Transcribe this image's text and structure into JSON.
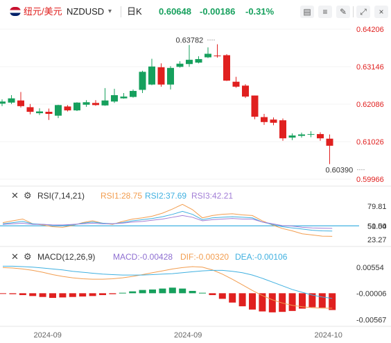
{
  "toolbar": {
    "pair_cn": "纽元/美元",
    "symbol": "NZDUSD",
    "dropdown_glyph": "▾",
    "period": "日K",
    "price": "0.60648",
    "change": "-0.00186",
    "change_pct": "-0.31%",
    "icons": [
      "candle-style-icon",
      "indicator-icon",
      "draw-tool-icon",
      "settings-icon",
      "fullscreen-icon",
      "close-icon"
    ]
  },
  "colors": {
    "up": "#16a05d",
    "down": "#e0201f",
    "axis_text": "#e0201f",
    "rsi1": "#f29d4f",
    "rsi2": "#3fb0e0",
    "rsi3": "#a27ed6",
    "macd_label": "#8e6fd1",
    "dif": "#f29d4f",
    "dea": "#3fb0e0"
  },
  "chart_data": [
    {
      "type": "candlestick",
      "title": "NZDUSD 日K",
      "y_ticks": [
        "0.64206",
        "0.63146",
        "0.62086",
        "0.61026",
        "0.59966"
      ],
      "ylim": [
        0.59966,
        0.64206
      ],
      "annotations": [
        {
          "label": "0.63782",
          "candle_index": 23,
          "value": 0.63782
        },
        {
          "label": "0.60390",
          "candle_index": 39,
          "value": 0.6039
        }
      ],
      "x_ticks": [
        {
          "label": "2024-09",
          "candle_index": 5
        },
        {
          "label": "2024-09",
          "candle_index": 20
        },
        {
          "label": "2024-10",
          "candle_index": 35
        }
      ],
      "candles": [
        {
          "o": 0.621,
          "c": 0.6216,
          "h": 0.6222,
          "l": 0.6203
        },
        {
          "o": 0.6213,
          "c": 0.6225,
          "h": 0.6234,
          "l": 0.6209
        },
        {
          "o": 0.6219,
          "c": 0.6203,
          "h": 0.6243,
          "l": 0.6199
        },
        {
          "o": 0.62,
          "c": 0.6187,
          "h": 0.6209,
          "l": 0.618
        },
        {
          "o": 0.6183,
          "c": 0.6188,
          "h": 0.6197,
          "l": 0.6178
        },
        {
          "o": 0.6187,
          "c": 0.6181,
          "h": 0.6196,
          "l": 0.6164
        },
        {
          "o": 0.6176,
          "c": 0.6206,
          "h": 0.6207,
          "l": 0.6169
        },
        {
          "o": 0.6202,
          "c": 0.6191,
          "h": 0.6206,
          "l": 0.6188
        },
        {
          "o": 0.6191,
          "c": 0.6213,
          "h": 0.6214,
          "l": 0.6189
        },
        {
          "o": 0.6207,
          "c": 0.6214,
          "h": 0.622,
          "l": 0.6201
        },
        {
          "o": 0.6212,
          "c": 0.6206,
          "h": 0.622,
          "l": 0.6204
        },
        {
          "o": 0.6205,
          "c": 0.6219,
          "h": 0.6254,
          "l": 0.6204
        },
        {
          "o": 0.6216,
          "c": 0.6234,
          "h": 0.6252,
          "l": 0.6212
        },
        {
          "o": 0.6225,
          "c": 0.623,
          "h": 0.624,
          "l": 0.6224
        },
        {
          "o": 0.6229,
          "c": 0.6246,
          "h": 0.625,
          "l": 0.6227
        },
        {
          "o": 0.6249,
          "c": 0.63,
          "h": 0.6303,
          "l": 0.624
        },
        {
          "o": 0.6264,
          "c": 0.6315,
          "h": 0.6337,
          "l": 0.6262
        },
        {
          "o": 0.6313,
          "c": 0.6264,
          "h": 0.6324,
          "l": 0.6258
        },
        {
          "o": 0.6264,
          "c": 0.6311,
          "h": 0.6316,
          "l": 0.625
        },
        {
          "o": 0.6314,
          "c": 0.6323,
          "h": 0.633,
          "l": 0.6312
        },
        {
          "o": 0.6322,
          "c": 0.6334,
          "h": 0.6376,
          "l": 0.6314
        },
        {
          "o": 0.6326,
          "c": 0.6336,
          "h": 0.6344,
          "l": 0.6324
        },
        {
          "o": 0.6341,
          "c": 0.6351,
          "h": 0.6369,
          "l": 0.6339
        },
        {
          "o": 0.6346,
          "c": 0.6345,
          "h": 0.6378,
          "l": 0.634
        },
        {
          "o": 0.6347,
          "c": 0.6275,
          "h": 0.635,
          "l": 0.6274
        },
        {
          "o": 0.6272,
          "c": 0.6258,
          "h": 0.6286,
          "l": 0.6255
        },
        {
          "o": 0.6261,
          "c": 0.623,
          "h": 0.6265,
          "l": 0.6226
        },
        {
          "o": 0.6233,
          "c": 0.6173,
          "h": 0.6233,
          "l": 0.6166
        },
        {
          "o": 0.6172,
          "c": 0.6158,
          "h": 0.6181,
          "l": 0.615
        },
        {
          "o": 0.6165,
          "c": 0.6156,
          "h": 0.6171,
          "l": 0.6149
        },
        {
          "o": 0.6163,
          "c": 0.6112,
          "h": 0.6168,
          "l": 0.6105
        },
        {
          "o": 0.6114,
          "c": 0.612,
          "h": 0.6126,
          "l": 0.6107
        },
        {
          "o": 0.6119,
          "c": 0.6123,
          "h": 0.6128,
          "l": 0.6114
        },
        {
          "o": 0.6123,
          "c": 0.6124,
          "h": 0.6132,
          "l": 0.6115
        },
        {
          "o": 0.6124,
          "c": 0.6112,
          "h": 0.6129,
          "l": 0.6105
        },
        {
          "o": 0.6111,
          "c": 0.6091,
          "h": 0.6123,
          "l": 0.6039
        }
      ]
    },
    {
      "type": "line",
      "title": "RSI(7,14,21)",
      "legend": [
        {
          "name": "RSI1",
          "label": "RSI1:28.75"
        },
        {
          "name": "RSI2",
          "label": "RSI2:37.69"
        },
        {
          "name": "RSI3",
          "label": "RSI3:42.21"
        }
      ],
      "y_ticks": [
        "79.81",
        "50.00",
        "51.54",
        "23.27"
      ],
      "ylim": [
        15,
        88
      ],
      "reference_value": 50.0,
      "series": [
        {
          "name": "RSI1",
          "values": [
            52,
            55,
            58,
            50,
            48,
            45,
            44,
            47,
            52,
            55,
            51,
            49,
            54,
            58,
            60,
            63,
            68,
            75,
            83,
            74,
            60,
            64,
            66,
            67,
            65,
            64,
            55,
            48,
            42,
            38,
            33,
            31,
            29,
            28.75
          ]
        },
        {
          "name": "RSI2",
          "values": [
            50,
            52,
            54,
            50,
            49,
            48,
            47,
            48,
            51,
            53,
            51,
            50,
            52,
            55,
            57,
            59,
            62,
            66,
            71,
            66,
            57,
            60,
            61,
            62,
            61,
            60,
            53,
            49,
            45,
            43,
            41,
            39,
            38,
            37.69
          ]
        },
        {
          "name": "RSI3",
          "values": [
            49,
            50,
            51,
            49,
            49,
            48,
            48,
            49,
            50,
            51,
            50,
            50,
            51,
            53,
            54,
            56,
            58,
            61,
            64,
            61,
            55,
            57,
            58,
            59,
            58,
            58,
            53,
            50,
            47,
            46,
            44,
            43,
            42.5,
            42.21
          ]
        }
      ]
    },
    {
      "type": "bar+line",
      "title": "MACD(12,26,9)",
      "legend": [
        {
          "name": "MACD",
          "label": "MACD:-0.00428"
        },
        {
          "name": "DIF",
          "label": "DIF:-0.00320"
        },
        {
          "name": "DEA",
          "label": "DEA:-0.00106"
        }
      ],
      "y_ticks": [
        "0.00554",
        "-0.00006",
        "-0.00567"
      ],
      "ylim": [
        -0.0068,
        0.0066
      ],
      "histogram": [
        -0.00012,
        -0.0002,
        -0.0004,
        -0.0006,
        -0.0008,
        -0.001,
        -0.0009,
        -0.0008,
        -0.0007,
        -0.0006,
        -0.0004,
        -0.0002,
        0.0001,
        0.0004,
        0.0007,
        0.0008,
        0.001,
        0.0012,
        0.001,
        0.0005,
        0.0001,
        -0.0004,
        -0.0012,
        -0.002,
        -0.0028,
        -0.0035,
        -0.0039,
        -0.0041,
        -0.004,
        -0.0038,
        -0.0033,
        -0.003,
        -0.0031,
        -0.0036
      ],
      "series": [
        {
          "name": "DIF",
          "values": [
            0.0055,
            0.0054,
            0.0052,
            0.0049,
            0.0045,
            0.004,
            0.0036,
            0.0033,
            0.0031,
            0.003,
            0.003,
            0.0031,
            0.0033,
            0.0036,
            0.004,
            0.0044,
            0.0048,
            0.0052,
            0.0055,
            0.0057,
            0.0056,
            0.005,
            0.0041,
            0.003,
            0.0018,
            0.0006,
            -0.0005,
            -0.0014,
            -0.0021,
            -0.0026,
            -0.0029,
            -0.0031,
            -0.0032,
            -0.0032
          ]
        },
        {
          "name": "DEA",
          "values": [
            0.0058,
            0.0058,
            0.0057,
            0.0056,
            0.0054,
            0.0052,
            0.005,
            0.0047,
            0.0045,
            0.0043,
            0.0041,
            0.004,
            0.0039,
            0.0039,
            0.0039,
            0.004,
            0.0041,
            0.0042,
            0.0044,
            0.0046,
            0.0048,
            0.0049,
            0.0049,
            0.0047,
            0.0044,
            0.0039,
            0.0032,
            0.0024,
            0.0016,
            0.0008,
            0.0002,
            -0.0004,
            -0.0008,
            -0.0011
          ]
        }
      ]
    }
  ]
}
